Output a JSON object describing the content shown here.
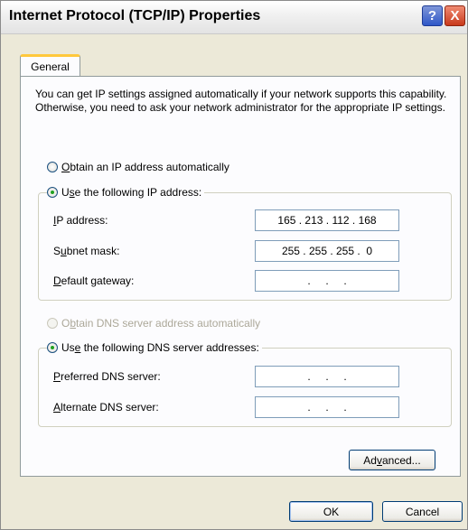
{
  "window": {
    "title": "Internet Protocol (TCP/IP) Properties",
    "help_label": "?",
    "close_label": "X"
  },
  "tabs": [
    {
      "label": "General"
    }
  ],
  "description": "You can get IP settings assigned automatically if your network supports this capability. Otherwise, you need to ask your network administrator for the appropriate IP settings.",
  "ip_mode": {
    "auto": {
      "prefix": "",
      "accel": "O",
      "rest": "btain an IP address automatically",
      "checked": false
    },
    "manual": {
      "prefix": "U",
      "accel": "s",
      "rest": "e the following IP address:",
      "checked": true
    }
  },
  "ip_fields": [
    {
      "accel": "I",
      "rest": "P address:",
      "value": "165 . 213 . 112 . 168"
    },
    {
      "prefix": "S",
      "accel": "u",
      "rest": "bnet mask:",
      "value": "255 . 255 . 255 .  0"
    },
    {
      "accel": "D",
      "rest": "efault gateway:",
      "value": "   .     .     .   "
    }
  ],
  "dns_mode": {
    "auto": {
      "prefix": "O",
      "accel": "b",
      "rest": "tain DNS server address automatically",
      "checked": false,
      "disabled": true
    },
    "manual": {
      "prefix": "Us",
      "accel": "e",
      "rest": " the following DNS server addresses:",
      "checked": true
    }
  },
  "dns_fields": [
    {
      "accel": "P",
      "rest": "referred DNS server:",
      "value": "   .     .     .   "
    },
    {
      "accel": "A",
      "rest": "lternate DNS server:",
      "value": "   .     .     .   "
    }
  ],
  "buttons": {
    "advanced": {
      "prefix": "Ad",
      "accel": "v",
      "rest": "anced..."
    },
    "ok": "OK",
    "cancel": "Cancel"
  }
}
